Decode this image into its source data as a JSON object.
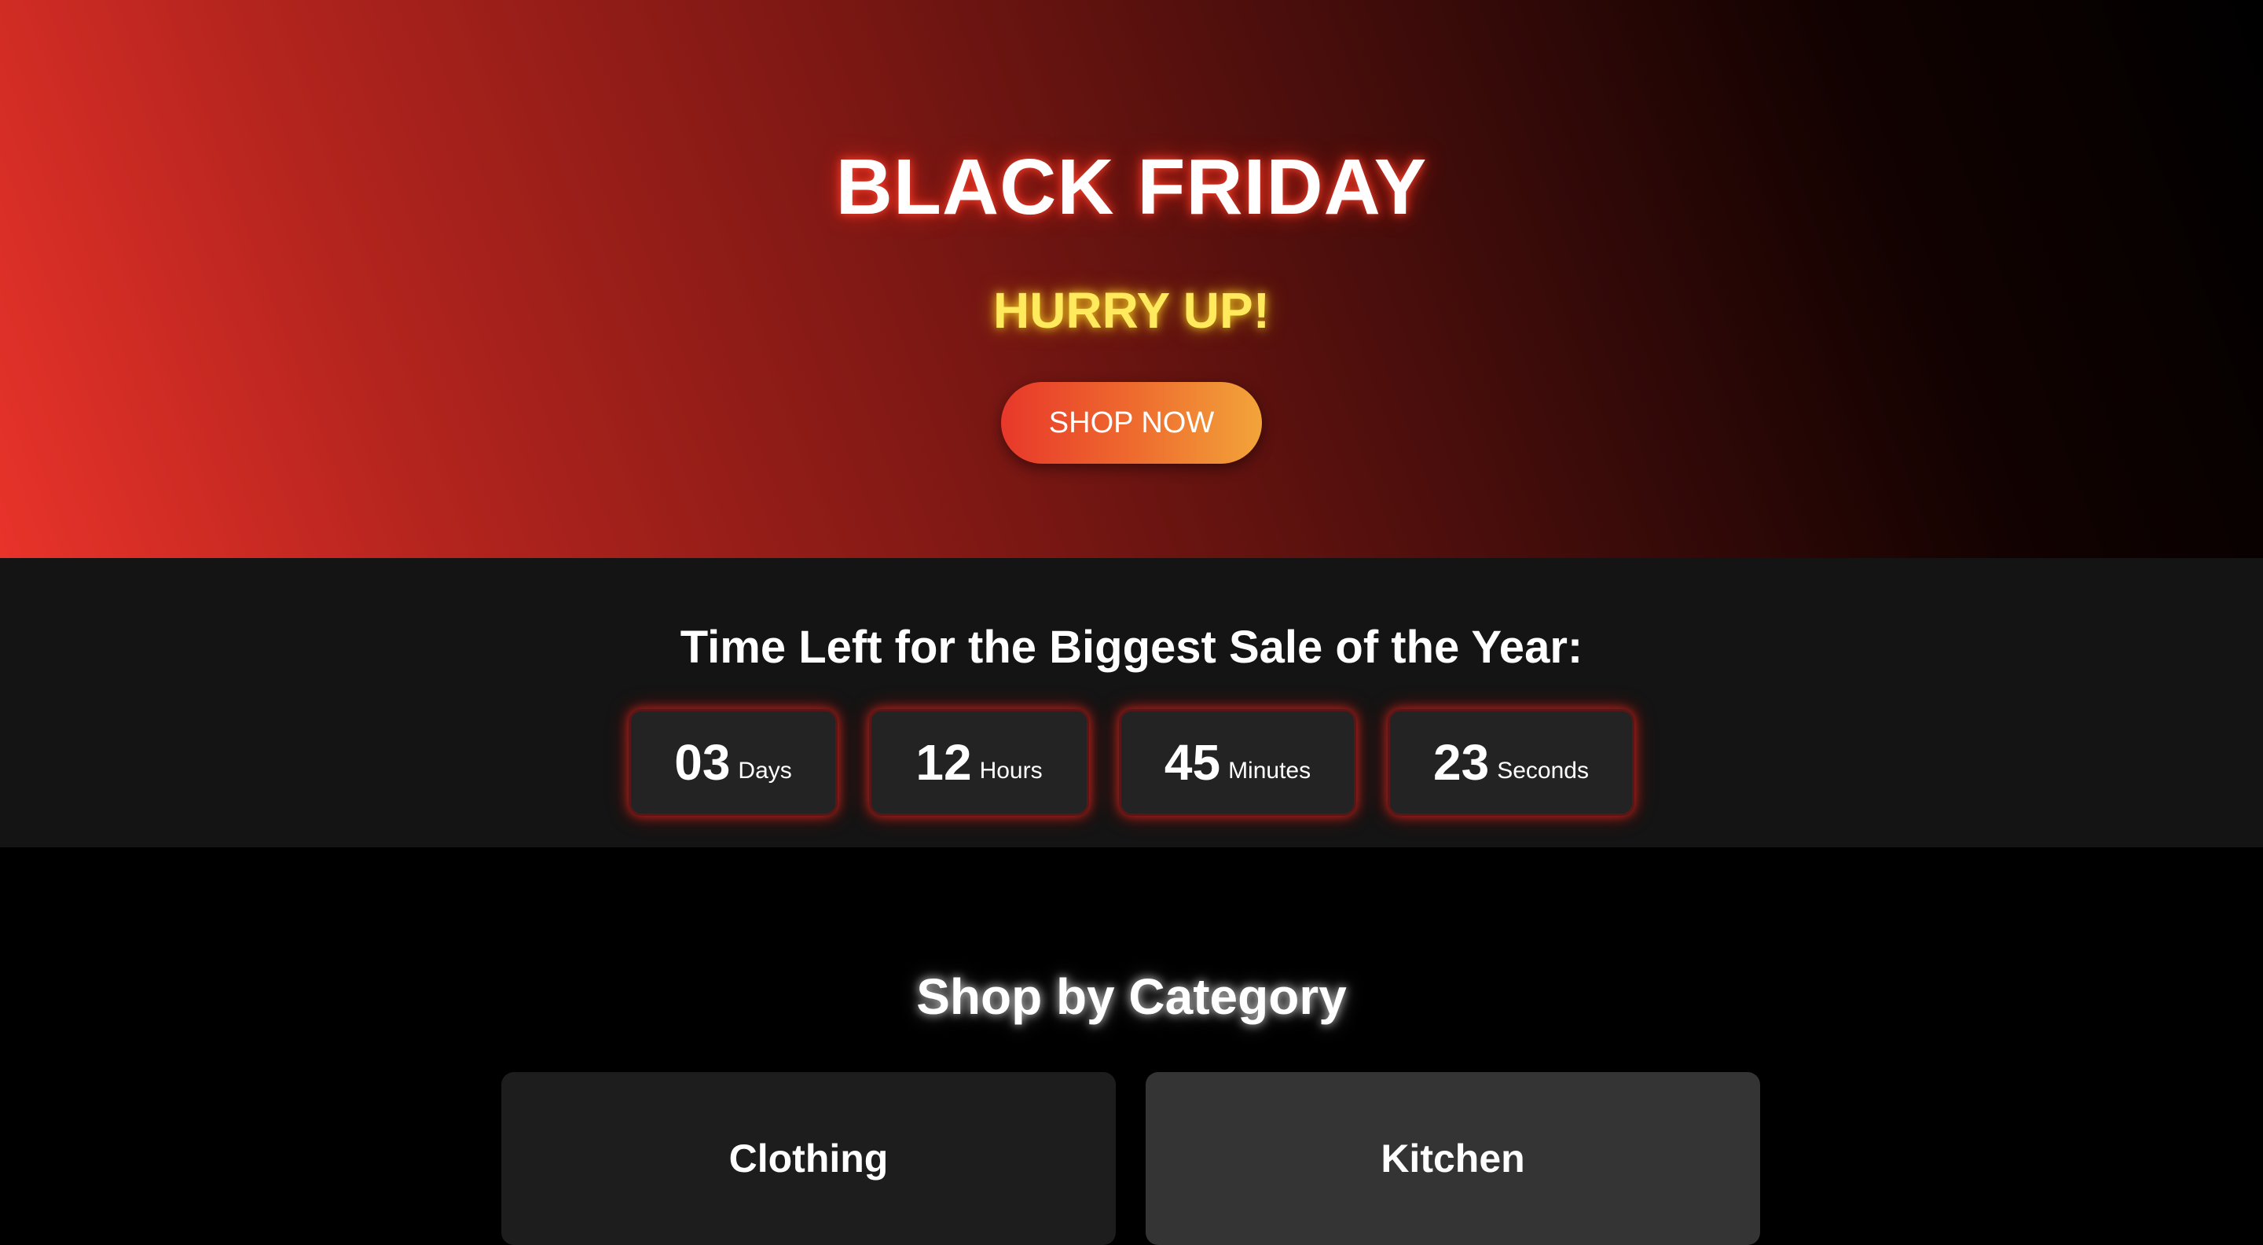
{
  "hero": {
    "title": "BLACK FRIDAY",
    "subtitle": "HURRY UP!",
    "cta_label": "SHOP NOW",
    "colors": {
      "gradient_start": "#e8332a",
      "gradient_end": "#000000",
      "title_glow": "#ff4632",
      "subtitle": "#ffe95c",
      "button_start": "#e8382a",
      "button_end": "#f2a43a"
    }
  },
  "countdown": {
    "title": "Time Left for the Biggest Sale of the Year:",
    "units": [
      {
        "value": "03",
        "label": "Days"
      },
      {
        "value": "12",
        "label": "Hours"
      },
      {
        "value": "45",
        "label": "Minutes"
      },
      {
        "value": "23",
        "label": "Seconds"
      }
    ],
    "colors": {
      "background": "#141414",
      "box": "#232323",
      "glow": "#e8281e"
    }
  },
  "categories": {
    "title": "Shop by Category",
    "items": [
      {
        "label": "Clothing"
      },
      {
        "label": "Kitchen"
      }
    ]
  }
}
